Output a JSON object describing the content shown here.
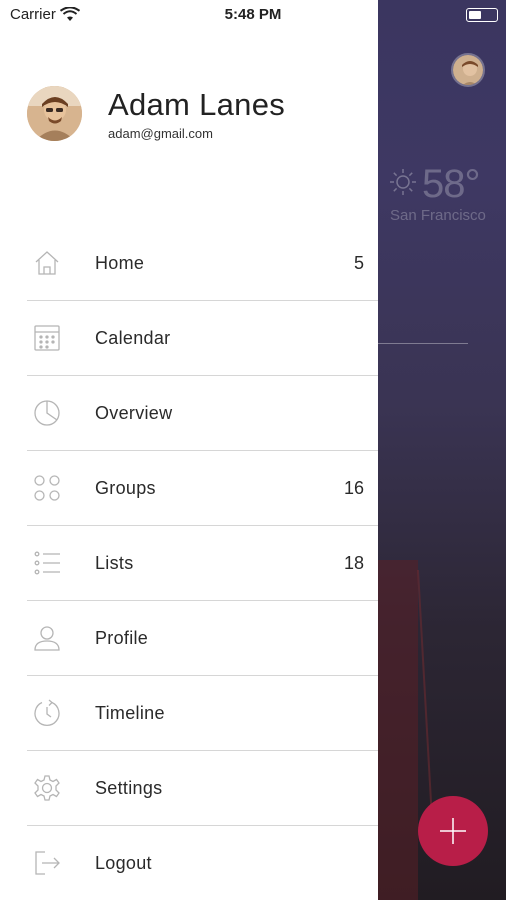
{
  "status_bar": {
    "carrier": "Carrier",
    "time": "5:48 PM"
  },
  "profile": {
    "name": "Adam Lanes",
    "email": "adam@gmail.com"
  },
  "menu": [
    {
      "label": "Home",
      "count": "5",
      "icon": "home-icon"
    },
    {
      "label": "Calendar",
      "count": "",
      "icon": "calendar-icon"
    },
    {
      "label": "Overview",
      "count": "",
      "icon": "pie-chart-icon"
    },
    {
      "label": "Groups",
      "count": "16",
      "icon": "groups-icon"
    },
    {
      "label": "Lists",
      "count": "18",
      "icon": "list-icon"
    },
    {
      "label": "Profile",
      "count": "",
      "icon": "user-icon"
    },
    {
      "label": "Timeline",
      "count": "",
      "icon": "clock-icon"
    },
    {
      "label": "Settings",
      "count": "",
      "icon": "gear-icon"
    },
    {
      "label": "Logout",
      "count": "",
      "icon": "logout-icon"
    }
  ],
  "background": {
    "temperature": "58°",
    "city": "San Francisco"
  },
  "colors": {
    "fab": "#b81e48",
    "drawer": "#ffffff",
    "divider": "#d6d6d6",
    "icon": "#b5b5b5"
  }
}
